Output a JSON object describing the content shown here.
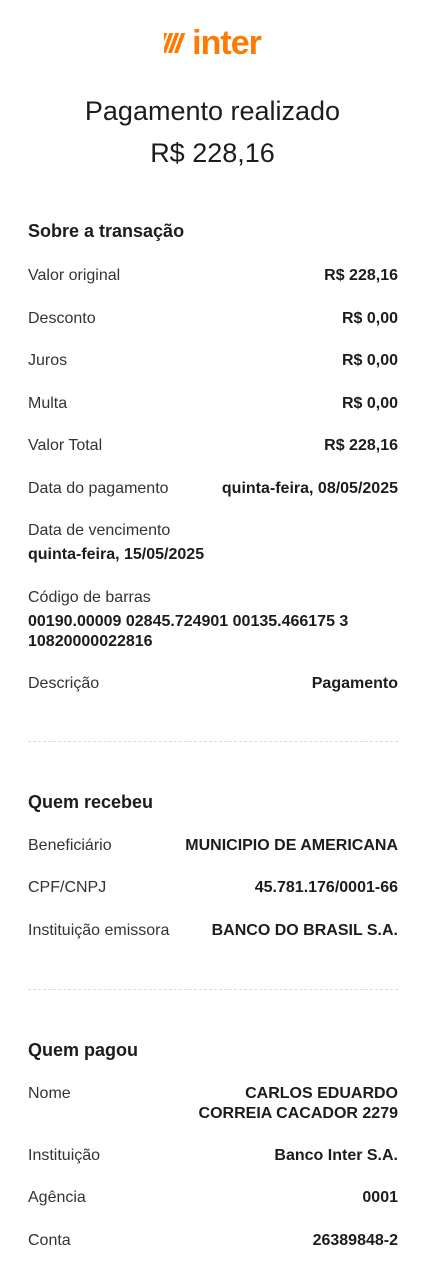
{
  "brand": {
    "name": "inter",
    "color": "#ff7a00"
  },
  "header": {
    "title": "Pagamento realizado",
    "amount": "R$ 228,16"
  },
  "transaction": {
    "section_title": "Sobre a transação",
    "rows": [
      {
        "label": "Valor original",
        "value": "R$ 228,16"
      },
      {
        "label": "Desconto",
        "value": "R$ 0,00"
      },
      {
        "label": "Juros",
        "value": "R$ 0,00"
      },
      {
        "label": "Multa",
        "value": "R$ 0,00"
      },
      {
        "label": "Valor Total",
        "value": "R$ 228,16"
      },
      {
        "label": "Data do pagamento",
        "value": "quinta-feira, 08/05/2025"
      }
    ],
    "due_date": {
      "label": "Data de vencimento",
      "value": "quinta-feira, 15/05/2025"
    },
    "barcode": {
      "label": "Código de barras",
      "value": "00190.00009 02845.724901 00135.466175 3 10820000022816"
    },
    "description": {
      "label": "Descrição",
      "value": "Pagamento"
    }
  },
  "receiver": {
    "section_title": "Quem recebeu",
    "rows": [
      {
        "label": "Beneficiário",
        "value": "MUNICIPIO DE AMERICANA"
      },
      {
        "label": "CPF/CNPJ",
        "value": "45.781.176/0001-66"
      },
      {
        "label": "Instituição emissora",
        "value": "BANCO DO BRASIL S.A."
      }
    ]
  },
  "payer": {
    "section_title": "Quem pagou",
    "rows": [
      {
        "label": "Nome",
        "value": "CARLOS EDUARDO CORREIA CACADOR 2279"
      },
      {
        "label": "Instituição",
        "value": "Banco Inter S.A."
      },
      {
        "label": "Agência",
        "value": "0001"
      },
      {
        "label": "Conta",
        "value": "26389848-2"
      }
    ]
  }
}
